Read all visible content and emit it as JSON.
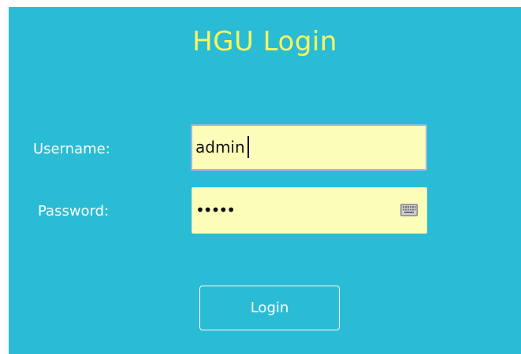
{
  "page": {
    "title": "HGU Login",
    "colors": {
      "panel": "#2bbcd5",
      "title": "#f6f760",
      "field": "#fbfdb9",
      "text": "#ffffff"
    }
  },
  "form": {
    "username_label": "Username:",
    "username_value": "admin",
    "password_label": "Password:",
    "password_masked": "•••••",
    "password_icon": "keyboard-icon",
    "login_label": "Login"
  }
}
